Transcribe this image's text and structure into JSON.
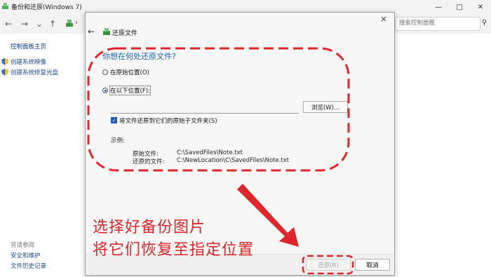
{
  "window": {
    "title": "备份和还原(Windows 7)",
    "controls": [
      "—",
      "□",
      "✕"
    ]
  },
  "nav": {
    "back": "←",
    "forward": "→",
    "dropdown": "⌄",
    "up": "↑",
    "breadcrumb_sep": "›",
    "search_placeholder": "搜索控制面板",
    "search_glyph": "⚲"
  },
  "sidebar": {
    "home_link": "控制面板主页",
    "links": [
      "创建系统映像",
      "创建系统修复光盘"
    ],
    "see_also_heading": "另请参阅",
    "see_also": [
      "安全和维护",
      "文件历史记录"
    ]
  },
  "dialog": {
    "close_glyph": "✕",
    "back_glyph": "←",
    "title": "还原文件",
    "question": "你想在何处还原文件?",
    "option_original": "在原始位置(O)",
    "option_other": "在以下位置(F):",
    "selected_option": "option_other",
    "path_value": "",
    "browse_label": "浏览(W)...",
    "checkbox_label": "将文件还原到它们的原始子文件夹(S)",
    "checkbox_checked": true,
    "example_heading": "示例:",
    "example_original_label": "原始文件:",
    "example_original_path": "C:\\SavedFiles\\Note.txt",
    "example_restored_label": "还原的文件:",
    "example_restored_path": "C:\\NewLocation\\C\\SavedFiles\\Note.txt",
    "restore_button": "还原(R)",
    "cancel_button": "取消"
  },
  "annotation": {
    "line1": "选择好备份图片",
    "line2": "将它们恢复至指定位置",
    "color": "#e0262a"
  }
}
